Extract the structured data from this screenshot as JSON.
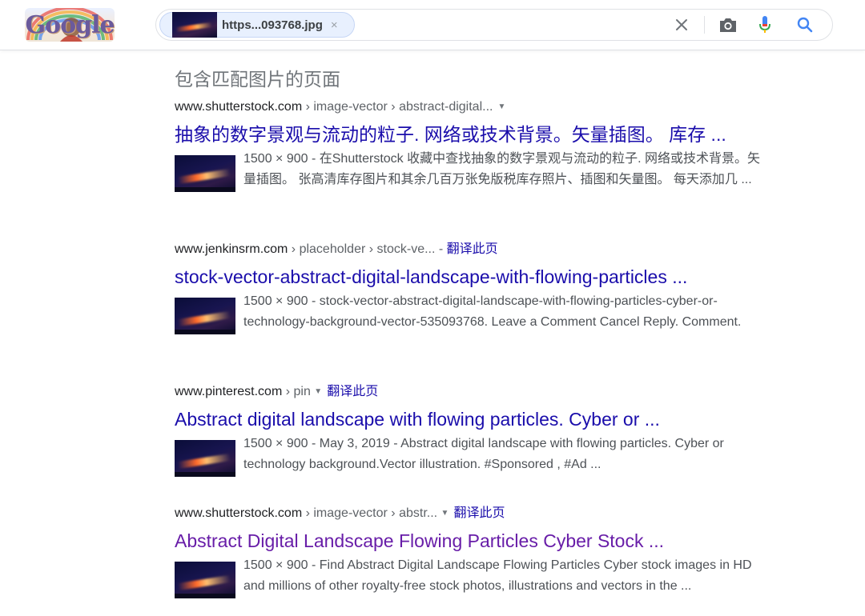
{
  "header": {
    "logo_text": "Google",
    "search_chip": {
      "label": "https...093768.jpg",
      "close_glyph": "×"
    },
    "icons": [
      "close-icon",
      "camera-icon",
      "mic-icon",
      "search-icon"
    ]
  },
  "section_title": "包含匹配图片的页面",
  "results": [
    {
      "domain": "www.shutterstock.com",
      "path": " › image-vector › abstract-digital...",
      "has_arrow": true,
      "translate": "",
      "title": "抽象的数字景观与流动的粒子. 网络或技术背景。矢量插图。 库存 ...",
      "snippet": "1500 × 900 - 在Shutterstock 收藏中查找抽象的数字景观与流动的粒子. 网络或技术背景。矢量插图。 张高清库存图片和其余几百万张免版税库存照片、插图和矢量图。 每天添加几 ...",
      "visited": false
    },
    {
      "domain": "www.jenkinsrm.com",
      "path": " › placeholder › stock-ve... - ",
      "has_arrow": false,
      "translate": "翻译此页",
      "title": "stock-vector-abstract-digital-landscape-with-flowing-particles ...",
      "snippet": "1500 × 900 - stock-vector-abstract-digital-landscape-with-flowing-particles-cyber-or-technology-background-vector-535093768. Leave a Comment Cancel Reply. Comment.",
      "visited": false
    },
    {
      "domain": "www.pinterest.com",
      "path": " › pin ",
      "has_arrow": true,
      "translate": "翻译此页",
      "title": "Abstract digital landscape with flowing particles. Cyber or ...",
      "snippet": "1500 × 900 - May 3, 2019 - Abstract digital landscape with flowing particles. Cyber or technology background.Vector illustration. #Sponsored , #Ad ...",
      "visited": false
    },
    {
      "domain": "www.shutterstock.com",
      "path": " › image-vector › abstr... ",
      "has_arrow": true,
      "translate": "翻译此页",
      "title": "Abstract Digital Landscape Flowing Particles Cyber Stock ...",
      "snippet": "1500 × 900 - Find Abstract Digital Landscape Flowing Particles Cyber stock images in HD and millions of other royalty-free stock photos, illustrations and vectors in the ...",
      "visited": true
    }
  ],
  "colors": {
    "link": "#1a0dab",
    "visited": "#681da8",
    "snippet": "#4d5156",
    "url": "#5f6368",
    "mic_blue": "#4285f4",
    "mic_red": "#ea4335"
  }
}
